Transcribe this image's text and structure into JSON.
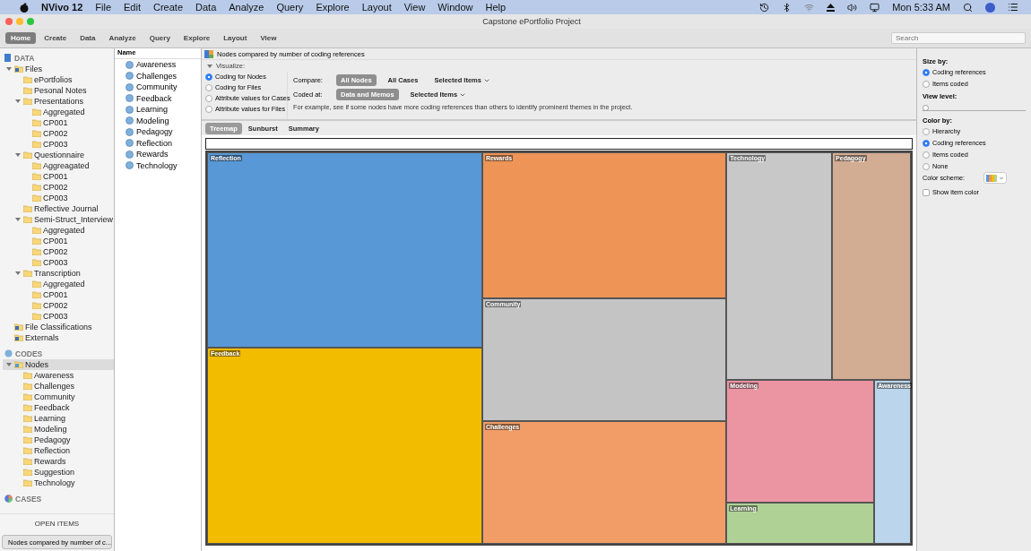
{
  "menubar": {
    "app": "NVivo 12",
    "menus": [
      "File",
      "Edit",
      "Create",
      "Data",
      "Analyze",
      "Query",
      "Explore",
      "Layout",
      "View",
      "Window",
      "Help"
    ],
    "clock": "Mon 5:33 AM"
  },
  "window": {
    "title": "Capstone ePortfolio Project"
  },
  "ribbon_tabs": [
    {
      "label": "Home",
      "selected": true
    },
    {
      "label": "Create",
      "selected": false
    },
    {
      "label": "Data",
      "selected": false
    },
    {
      "label": "Analyze",
      "selected": false
    },
    {
      "label": "Query",
      "selected": false
    },
    {
      "label": "Explore",
      "selected": false
    },
    {
      "label": "Layout",
      "selected": false
    },
    {
      "label": "View",
      "selected": false
    }
  ],
  "search": {
    "placeholder": "Search"
  },
  "navigation": [
    {
      "label": "DATA",
      "kind": "data",
      "items": [
        {
          "label": "Files",
          "kind": "files",
          "expanded": true,
          "selected": false,
          "children": [
            {
              "label": "ePortfolios",
              "kind": "folder",
              "selected": false
            },
            {
              "label": "Pesonal Notes",
              "kind": "folder",
              "selected": false
            },
            {
              "label": "Presentations",
              "kind": "folder",
              "expanded": true,
              "selected": false,
              "children": [
                {
                  "label": "Aggregated",
                  "kind": "folder",
                  "selected": false
                },
                {
                  "label": "CP001",
                  "kind": "folder",
                  "selected": false
                },
                {
                  "label": "CP002",
                  "kind": "folder",
                  "selected": false
                },
                {
                  "label": "CP003",
                  "kind": "folder",
                  "selected": false
                }
              ]
            },
            {
              "label": "Questionnaire",
              "kind": "folder",
              "expanded": true,
              "selected": false,
              "children": [
                {
                  "label": "Aggreagated",
                  "kind": "folder",
                  "selected": false
                },
                {
                  "label": "CP001",
                  "kind": "folder",
                  "selected": false
                },
                {
                  "label": "CP002",
                  "kind": "folder",
                  "selected": false
                },
                {
                  "label": "CP003",
                  "kind": "folder",
                  "selected": false
                }
              ]
            },
            {
              "label": "Reflective Journal",
              "kind": "folder",
              "selected": false
            },
            {
              "label": "Semi-Struct_Interview",
              "kind": "folder",
              "expanded": true,
              "selected": false,
              "children": [
                {
                  "label": "Aggregated",
                  "kind": "folder",
                  "selected": false
                },
                {
                  "label": "CP001",
                  "kind": "folder",
                  "selected": false
                },
                {
                  "label": "CP002",
                  "kind": "folder",
                  "selected": false
                },
                {
                  "label": "CP003",
                  "kind": "folder",
                  "selected": false
                }
              ]
            },
            {
              "label": "Transcription",
              "kind": "folder",
              "expanded": true,
              "selected": false,
              "children": [
                {
                  "label": "Aggregated",
                  "kind": "folder",
                  "selected": false
                },
                {
                  "label": "CP001",
                  "kind": "folder",
                  "selected": false
                },
                {
                  "label": "CP002",
                  "kind": "folder",
                  "selected": false
                },
                {
                  "label": "CP003",
                  "kind": "folder",
                  "selected": false
                }
              ]
            }
          ]
        },
        {
          "label": "File Classifications",
          "kind": "classification",
          "selected": false
        },
        {
          "label": "Externals",
          "kind": "externals",
          "selected": false
        }
      ]
    },
    {
      "label": "CODES",
      "kind": "codes",
      "items": [
        {
          "label": "Nodes",
          "kind": "nodes",
          "expanded": true,
          "selected": true,
          "children": [
            {
              "label": "Awareness",
              "kind": "folder",
              "selected": false
            },
            {
              "label": "Challenges",
              "kind": "folder",
              "selected": false
            },
            {
              "label": "Community",
              "kind": "folder",
              "selected": false
            },
            {
              "label": "Feedback",
              "kind": "folder",
              "selected": false
            },
            {
              "label": "Learning",
              "kind": "folder",
              "selected": false
            },
            {
              "label": "Modeling",
              "kind": "folder",
              "selected": false
            },
            {
              "label": "Pedagogy",
              "kind": "folder",
              "selected": false
            },
            {
              "label": "Reflection",
              "kind": "folder",
              "selected": false
            },
            {
              "label": "Rewards",
              "kind": "folder",
              "selected": false
            },
            {
              "label": "Suggestion",
              "kind": "folder",
              "selected": false
            },
            {
              "label": "Technology",
              "kind": "folder",
              "selected": false
            }
          ]
        }
      ]
    },
    {
      "label": "CASES",
      "kind": "cases"
    }
  ],
  "open_items": {
    "label": "OPEN ITEMS",
    "items": [
      "Nodes compared by number of c..."
    ]
  },
  "node_list": {
    "column": "Name",
    "items": [
      "Awareness",
      "Challenges",
      "Community",
      "Feedback",
      "Learning",
      "Modeling",
      "Pedagogy",
      "Reflection",
      "Rewards",
      "Technology"
    ]
  },
  "visualization": {
    "title": "Nodes compared by number of coding references",
    "section": "Visualize:",
    "expanded": true,
    "options": [
      {
        "label": "Coding for Nodes",
        "selected": true
      },
      {
        "label": "Coding for Files",
        "selected": false
      },
      {
        "label": "Attribute values for Cases",
        "selected": false
      },
      {
        "label": "Attribute values for Files",
        "selected": false
      }
    ],
    "rows": [
      {
        "label": "Compare:",
        "choices": [
          {
            "label": "All Nodes",
            "kind": "pill",
            "selected": true
          },
          {
            "label": "All Cases",
            "kind": "plain",
            "selected": false
          },
          {
            "label": "Selected Items",
            "kind": "dropdown",
            "selected": false
          }
        ]
      },
      {
        "label": "Coded at:",
        "choices": [
          {
            "label": "Data and Memos",
            "kind": "pill",
            "selected": true
          },
          {
            "label": "Selected Items",
            "kind": "dropdown",
            "selected": false
          }
        ]
      }
    ],
    "hint": "For example, see if some nodes have more coding references than others to identify prominent themes in the project."
  },
  "view_tabs": [
    {
      "label": "Treemap",
      "selected": true
    },
    {
      "label": "Sunburst",
      "selected": false
    },
    {
      "label": "Summary",
      "selected": false
    }
  ],
  "treemap": [
    {
      "label": "Reflection",
      "color": "#5898d6"
    },
    {
      "label": "Feedback",
      "color": "#f2bc00"
    },
    {
      "label": "Rewards",
      "color": "#ee9457"
    },
    {
      "label": "Community",
      "color": "#c4c4c4"
    },
    {
      "label": "Challenges",
      "color": "#f29d67"
    },
    {
      "label": "Technology",
      "color": "#c8c8c8"
    },
    {
      "label": "Pedagogy",
      "color": "#d2ad94"
    },
    {
      "label": "Modeling",
      "color": "#eb94a2"
    },
    {
      "label": "Learning",
      "color": "#b0d196"
    },
    {
      "label": "Awareness",
      "color": "#bbd5ec"
    }
  ],
  "settings": {
    "size_by": {
      "label": "Size by:",
      "options": [
        {
          "label": "Coding references",
          "selected": true
        },
        {
          "label": "Items coded",
          "selected": false
        }
      ]
    },
    "view_level": {
      "label": "View level:",
      "level": 0
    },
    "color_by": {
      "label": "Color by:",
      "options": [
        {
          "label": "Hierarchy",
          "selected": false
        },
        {
          "label": "Coding references",
          "selected": true
        },
        {
          "label": "Items coded",
          "selected": false
        },
        {
          "label": "None",
          "selected": false
        }
      ]
    },
    "color_scheme": {
      "label": "Color scheme:"
    },
    "show_item_color": {
      "label": "Show item color",
      "checked": false
    }
  }
}
